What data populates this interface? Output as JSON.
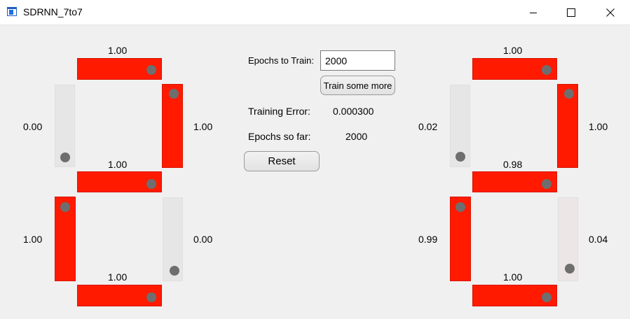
{
  "window": {
    "title": "SDRNN_7to7",
    "icons": {
      "app": "app-icon",
      "minimize": "minimize-icon",
      "maximize": "maximize-icon",
      "close": "close-icon"
    },
    "colors": {
      "segment_on": "#ff1a00",
      "segment_off": "#e6e6e6",
      "indicator": "#6e6e6e"
    }
  },
  "left_display": {
    "top": {
      "label": "1.00",
      "state": "on"
    },
    "upper_left": {
      "label": "0.00",
      "state": "off"
    },
    "upper_right": {
      "label": "1.00",
      "state": "on"
    },
    "middle": {
      "label": "1.00",
      "state": "on"
    },
    "lower_left": {
      "label": "1.00",
      "state": "on"
    },
    "lower_right": {
      "label": "0.00",
      "state": "off"
    },
    "bottom": {
      "label": "1.00",
      "state": "on"
    }
  },
  "right_display": {
    "top": {
      "label": "1.00",
      "state": "on"
    },
    "upper_left": {
      "label": "0.02",
      "state": "off"
    },
    "upper_right": {
      "label": "1.00",
      "state": "on"
    },
    "middle": {
      "label": "0.98",
      "state": "on"
    },
    "lower_left": {
      "label": "0.99",
      "state": "on"
    },
    "lower_right": {
      "label": "0.04",
      "state": "off"
    },
    "bottom": {
      "label": "1.00",
      "state": "on"
    }
  },
  "controls": {
    "epochs_label": "Epochs to Train:",
    "epochs_value": "2000",
    "train_button": "Train some more",
    "training_error_label": "Training Error:",
    "training_error_value": "0.000300",
    "epochs_so_far_label": "Epochs so far:",
    "epochs_so_far_value": "2000",
    "reset_button": "Reset"
  }
}
